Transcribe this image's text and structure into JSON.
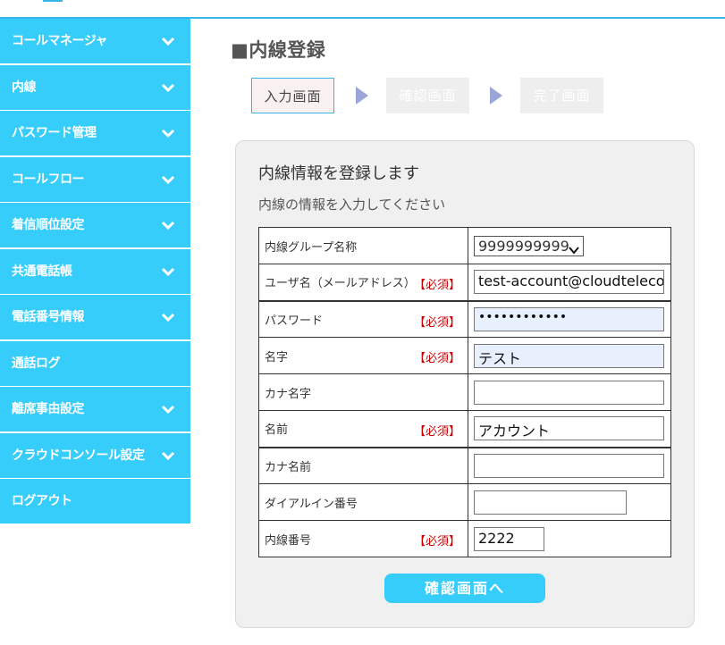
{
  "sidebar": {
    "items": [
      {
        "label": "コールマネージャ",
        "icon": "chevron-down-icon"
      },
      {
        "label": "内線",
        "icon": "chevron-down-icon"
      },
      {
        "label": "パスワード管理",
        "icon": "chevron-down-icon"
      },
      {
        "label": "コールフロー",
        "icon": "chevron-down-icon"
      },
      {
        "label": "着信順位設定",
        "icon": "chevron-down-icon"
      },
      {
        "label": "共通電話帳",
        "icon": "chevron-down-icon"
      },
      {
        "label": "電話番号情報",
        "icon": "chevron-down-icon"
      },
      {
        "label": "通話ログ"
      },
      {
        "label": "離席事由設定",
        "icon": "chevron-down-icon"
      },
      {
        "label": "クラウドコンソール設定",
        "icon": "chevron-down-icon"
      },
      {
        "label": "ログアウト"
      }
    ]
  },
  "page": {
    "title": "■内線登録"
  },
  "steps": [
    {
      "label": "入力画面",
      "state": "active"
    },
    {
      "label": "確認画面",
      "state": "inactive"
    },
    {
      "label": "完了画面",
      "state": "inactive"
    }
  ],
  "panel": {
    "heading": "内線情報を登録します",
    "subheading": "内線の情報を入力してください",
    "required_mark": "【必須】",
    "fields": {
      "group": {
        "label": "内線グループ名称",
        "value": "9999999999"
      },
      "username": {
        "label": "ユーザ名（メールアドレス）",
        "value": "test-account@cloudtelecom"
      },
      "password": {
        "label": "パスワード",
        "value": "••••••••••••"
      },
      "last_name": {
        "label": "名字",
        "value": "テスト"
      },
      "kana_last_name": {
        "label": "カナ名字",
        "value": ""
      },
      "first_name": {
        "label": "名前",
        "value": "アカウント"
      },
      "kana_first_name": {
        "label": "カナ名前",
        "value": ""
      },
      "dial_in": {
        "label": "ダイアルイン番号",
        "value": ""
      },
      "extension": {
        "label": "内線番号",
        "value": "2222"
      }
    },
    "submit_label": "確認画面へ"
  },
  "colors": {
    "accent": "#36cdfb",
    "required": "#cc0000",
    "autofill": "#e8f0fe",
    "step_arrow": "#9aa6d8"
  }
}
